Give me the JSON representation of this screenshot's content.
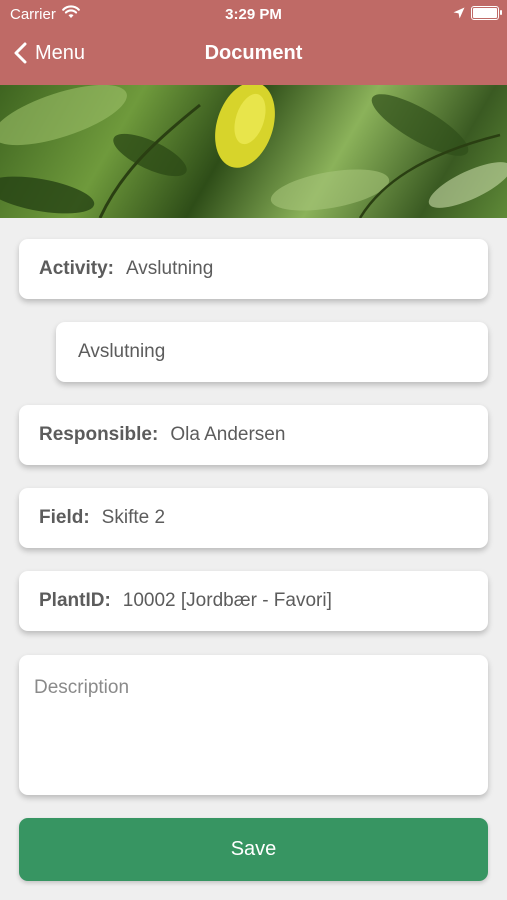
{
  "status_bar": {
    "carrier": "Carrier",
    "time": "3:29 PM"
  },
  "nav": {
    "back_label": "Menu",
    "title": "Document"
  },
  "form": {
    "activity": {
      "label": "Activity:",
      "value": "Avslutning"
    },
    "sub_activity": {
      "value": "Avslutning"
    },
    "responsible": {
      "label": "Responsible:",
      "value": "Ola Andersen"
    },
    "field": {
      "label": "Field:",
      "value": "Skifte 2"
    },
    "plant": {
      "label": "PlantID:",
      "value": "10002 [Jordbær - Favori]"
    },
    "description": {
      "placeholder": "Description",
      "value": ""
    }
  },
  "actions": {
    "save_label": "Save"
  },
  "colors": {
    "header": "#bf6a66",
    "save_button": "#379562",
    "background": "#efefef"
  }
}
